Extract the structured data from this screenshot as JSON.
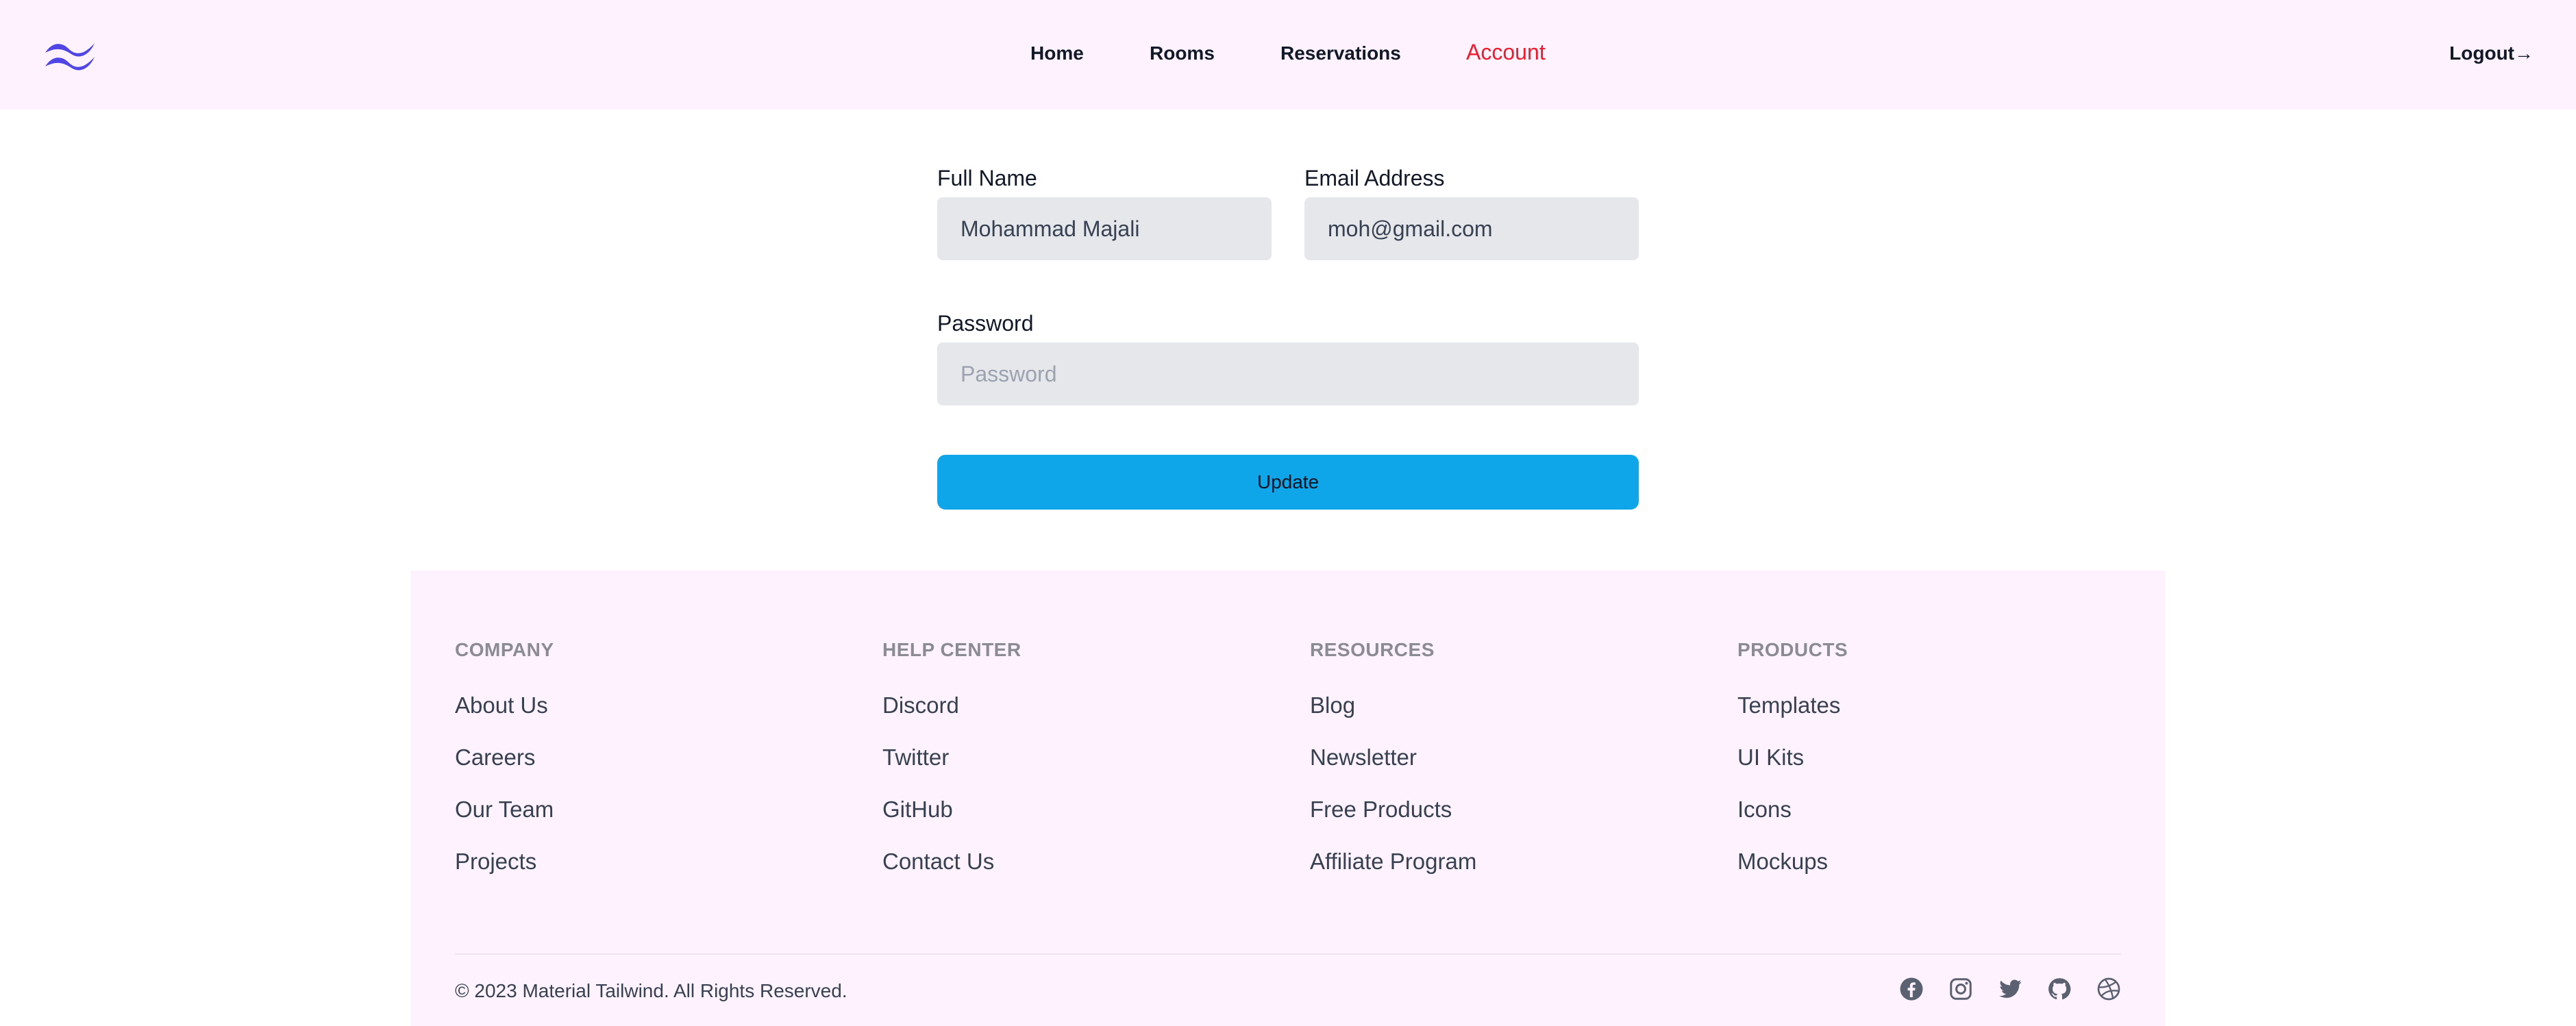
{
  "header": {
    "nav": [
      {
        "label": "Home"
      },
      {
        "label": "Rooms"
      },
      {
        "label": "Reservations"
      },
      {
        "label": "Account",
        "active": true
      }
    ],
    "logout_label": "Logout→",
    "logo_icon": "wave-logo-icon",
    "accent_color": "#ef1b2d"
  },
  "form": {
    "full_name_label": "Full Name",
    "full_name_value": "Mohammad Majali",
    "email_label": "Email Address",
    "email_value": "moh@gmail.com",
    "password_label": "Password",
    "password_placeholder": "Password",
    "update_label": "Update",
    "button_color": "#0ea5e9"
  },
  "footer": {
    "columns": [
      {
        "heading": "COMPANY",
        "links": [
          "About Us",
          "Careers",
          "Our Team",
          "Projects"
        ]
      },
      {
        "heading": "HELP CENTER",
        "links": [
          "Discord",
          "Twitter",
          "GitHub",
          "Contact Us"
        ]
      },
      {
        "heading": "RESOURCES",
        "links": [
          "Blog",
          "Newsletter",
          "Free Products",
          "Affiliate Program"
        ]
      },
      {
        "heading": "PRODUCTS",
        "links": [
          "Templates",
          "UI Kits",
          "Icons",
          "Mockups"
        ]
      }
    ],
    "copyright": "© 2023 Material Tailwind. All Rights Reserved.",
    "social_icons": [
      "facebook-icon",
      "instagram-icon",
      "twitter-icon",
      "github-icon",
      "dribbble-icon"
    ]
  }
}
